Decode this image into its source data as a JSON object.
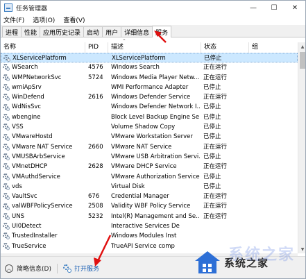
{
  "window": {
    "title": "任务管理器"
  },
  "window_controls": {
    "minimize": "—",
    "maximize": "☐",
    "close": "✕"
  },
  "menu": [
    "文件(F)",
    "选项(O)",
    "查看(V)"
  ],
  "tabs": [
    "进程",
    "性能",
    "应用历史记录",
    "启动",
    "用户",
    "详细信息",
    "服务"
  ],
  "active_tab": "服务",
  "columns": {
    "name": "名称",
    "pid": "PID",
    "desc": "描述",
    "status": "状态",
    "group": "组"
  },
  "services": [
    {
      "name": "XLServicePlatform",
      "pid": "",
      "desc": "XLServicePlatform",
      "status": "已停止",
      "group": ""
    },
    {
      "name": "WSearch",
      "pid": "4576",
      "desc": "Windows Search",
      "status": "正在运行",
      "group": ""
    },
    {
      "name": "WMPNetworkSvc",
      "pid": "5724",
      "desc": "Windows Media Player Netw...",
      "status": "正在运行",
      "group": ""
    },
    {
      "name": "wmiApSrv",
      "pid": "",
      "desc": "WMI Performance Adapter",
      "status": "已停止",
      "group": ""
    },
    {
      "name": "WinDefend",
      "pid": "2616",
      "desc": "Windows Defender Service",
      "status": "正在运行",
      "group": ""
    },
    {
      "name": "WdNisSvc",
      "pid": "",
      "desc": "Windows Defender Network I...",
      "status": "已停止",
      "group": ""
    },
    {
      "name": "wbengine",
      "pid": "",
      "desc": "Block Level Backup Engine Se...",
      "status": "已停止",
      "group": ""
    },
    {
      "name": "VSS",
      "pid": "",
      "desc": "Volume Shadow Copy",
      "status": "已停止",
      "group": ""
    },
    {
      "name": "VMwareHostd",
      "pid": "",
      "desc": "VMware Workstation Server",
      "status": "已停止",
      "group": ""
    },
    {
      "name": "VMware NAT Service",
      "pid": "2660",
      "desc": "VMware NAT Service",
      "status": "正在运行",
      "group": ""
    },
    {
      "name": "VMUSBArbService",
      "pid": "",
      "desc": "VMware USB Arbitration Servi...",
      "status": "已停止",
      "group": ""
    },
    {
      "name": "VMnetDHCP",
      "pid": "2628",
      "desc": "VMware DHCP Service",
      "status": "正在运行",
      "group": ""
    },
    {
      "name": "VMAuthdService",
      "pid": "",
      "desc": "VMware Authorization Service",
      "status": "已停止",
      "group": ""
    },
    {
      "name": "vds",
      "pid": "",
      "desc": "Virtual Disk",
      "status": "已停止",
      "group": ""
    },
    {
      "name": "VaultSvc",
      "pid": "676",
      "desc": "Credential Manager",
      "status": "正在运行",
      "group": ""
    },
    {
      "name": "valWBFPolicyService",
      "pid": "2508",
      "desc": "Validity WBF Policy Service",
      "status": "正在运行",
      "group": ""
    },
    {
      "name": "UNS",
      "pid": "5232",
      "desc": "Intel(R) Management and Se...",
      "status": "正在运行",
      "group": ""
    },
    {
      "name": "UI0Detect",
      "pid": "",
      "desc": "Interactive Services De",
      "status": "",
      "group": ""
    },
    {
      "name": "TrustedInstaller",
      "pid": "",
      "desc": "Windows Modules Inst",
      "status": "",
      "group": ""
    },
    {
      "name": "TrueService",
      "pid": "",
      "desc": "TrueAPI Service comp",
      "status": "",
      "group": ""
    }
  ],
  "footer": {
    "fewer_details": "简略信息(D)",
    "open_services": "打开服务"
  },
  "watermark": {
    "text": "系统之家",
    "ghost": "系统之家"
  },
  "colors": {
    "selection": "#cce8ff",
    "annotation_arrow": "#e01010",
    "link": "#1a5fb4"
  }
}
